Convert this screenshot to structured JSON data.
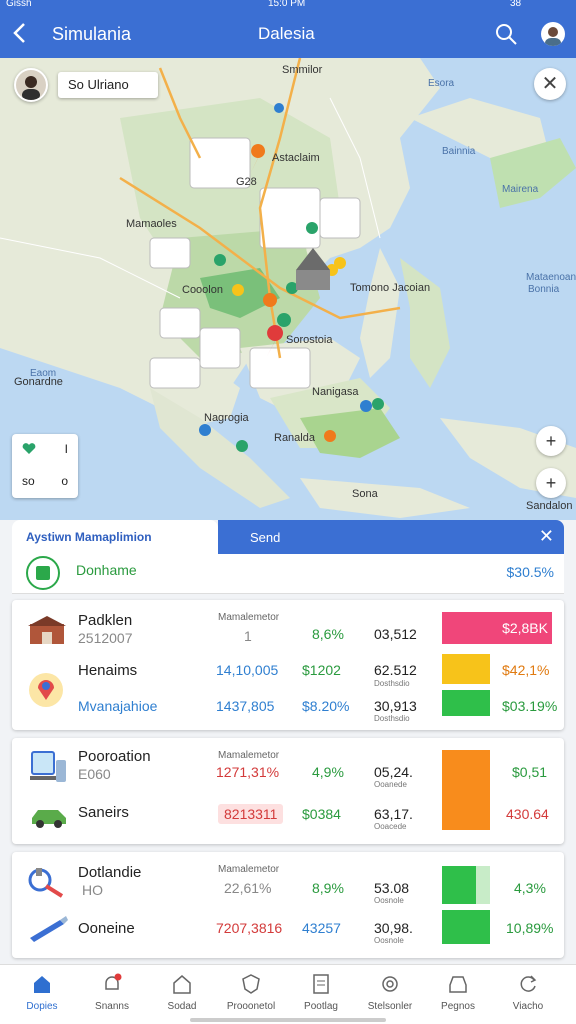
{
  "status": {
    "carrier": "Gissh",
    "time": "15:0 PM",
    "battery": "38"
  },
  "header": {
    "title": "Simulania",
    "center_title": "Dalesia"
  },
  "map": {
    "chip_label": "So Ulriano",
    "legend": {
      "row1_value": "I",
      "row2_label": "so",
      "row2_value": "o"
    },
    "labels": {
      "city1": "Astaclaim",
      "city2": "Cooolon",
      "city3": "Sorostoia",
      "city4": "Nagrogia",
      "city5": "Ranalda",
      "city6": "Mamaoles",
      "city7": "Nanigasa",
      "city8": "Sona",
      "city9": "Sandalon",
      "city10": "Gonardne",
      "sea1": "Esora",
      "sea2": "Bainnia",
      "sea3": "Mairena",
      "sea4": "Mataenoan",
      "sea5": "Eaom",
      "sea6": "Bonnia",
      "road1": "G28",
      "road2": "Smmilor",
      "road3": "Tomono Jacoian"
    }
  },
  "tabs": {
    "left_label": "Aystiwn Mamaplimion",
    "right_label": "Send"
  },
  "summary": {
    "name": "Donhame",
    "percent": "$30.5%"
  },
  "card1": {
    "header": "Mamalemetor",
    "rows": [
      {
        "name": "Padklen",
        "sub": "2512007",
        "col1": "1",
        "col2": "8,6%",
        "col3": "03,512",
        "bar": "$2,8BK"
      },
      {
        "name": "Henaims",
        "col1": "14,10,005",
        "col2": "$1202",
        "col3": "62.512",
        "col3_sub": "Dosthsdio",
        "bar": "$42,1%"
      },
      {
        "name": "Mvanajahioe",
        "col1": "1437,805",
        "col2": "$8.20%",
        "col3": "30,913",
        "col3_sub": "Dosthsdio",
        "bar": "$03.19%"
      }
    ]
  },
  "card2": {
    "header": "Mamalemetor",
    "rows": [
      {
        "name": "Pooroation",
        "sub": "E060",
        "col1": "1271,31%",
        "col2": "4,9%",
        "col3": "05,24.",
        "col3_sub": "Ooanede",
        "bar": "$0,51"
      },
      {
        "name": "Saneirs",
        "col1": "8213311",
        "col2": "$0384",
        "col3": "63,17.",
        "col3_sub": "Ooacede",
        "bar": "430.64"
      }
    ]
  },
  "card3": {
    "header": "Mamalemetor",
    "rows": [
      {
        "name": "Dotlandie",
        "sub": "HO",
        "col1": "22,61%",
        "col2": "8,9%",
        "col3": "53.08",
        "col3_sub": "Oosnole",
        "bar": "4,3%"
      },
      {
        "name": "Ooneine",
        "col1": "7207,3816",
        "col2": "43257",
        "col3": "30,98.",
        "col3_sub": "Oosnole",
        "bar": "10,89%"
      }
    ]
  },
  "nav": [
    {
      "label": "Dopies",
      "icon": "home-icon"
    },
    {
      "label": "Snanns",
      "icon": "bell-icon"
    },
    {
      "label": "Sodad",
      "icon": "house-icon"
    },
    {
      "label": "Prooonetol",
      "icon": "shield-icon"
    },
    {
      "label": "Pootlag",
      "icon": "document-icon"
    },
    {
      "label": "Stelsonler",
      "icon": "gear-icon"
    },
    {
      "label": "Pegnos",
      "icon": "tray-icon"
    },
    {
      "label": "Viacho",
      "icon": "refresh-icon"
    }
  ],
  "colors": {
    "primary": "#3b6fd3",
    "pink": "#f0467a",
    "yellow": "#f7c31a",
    "green": "#2fbf4a",
    "orange": "#f88c1c"
  }
}
